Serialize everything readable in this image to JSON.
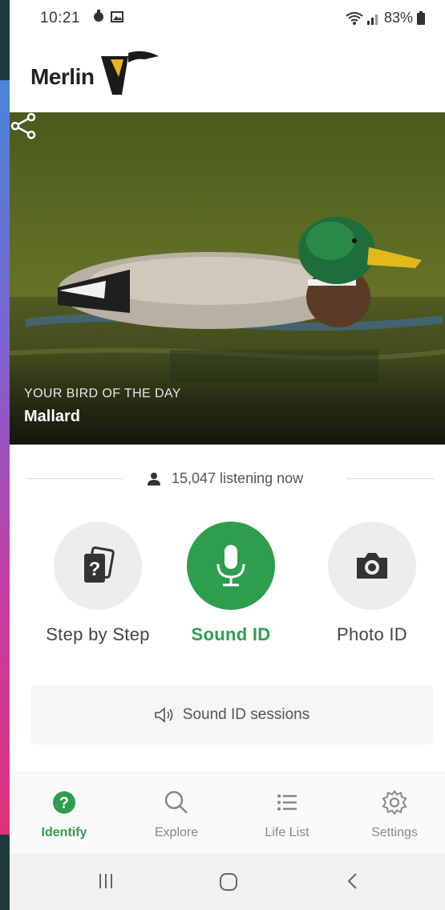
{
  "status_bar": {
    "time": "10:21",
    "battery": "83%"
  },
  "header": {
    "app_name": "Merlin"
  },
  "bird_of_day": {
    "kicker": "YOUR BIRD OF THE DAY",
    "name": "Mallard"
  },
  "listening": {
    "text": "15,047 listening now"
  },
  "options": [
    {
      "label": "Step by Step",
      "icon": "question-cards-icon"
    },
    {
      "label": "Sound ID",
      "icon": "microphone-icon"
    },
    {
      "label": "Photo ID",
      "icon": "camera-icon"
    }
  ],
  "sessions": {
    "label": "Sound ID sessions"
  },
  "bottom_nav": [
    {
      "label": "Identify",
      "icon": "question-icon",
      "active": true
    },
    {
      "label": "Explore",
      "icon": "search-icon"
    },
    {
      "label": "Life List",
      "icon": "list-icon"
    },
    {
      "label": "Settings",
      "icon": "gear-icon"
    }
  ],
  "colors": {
    "accent": "#2e9e4e",
    "hero_caption": "#ffffff"
  }
}
